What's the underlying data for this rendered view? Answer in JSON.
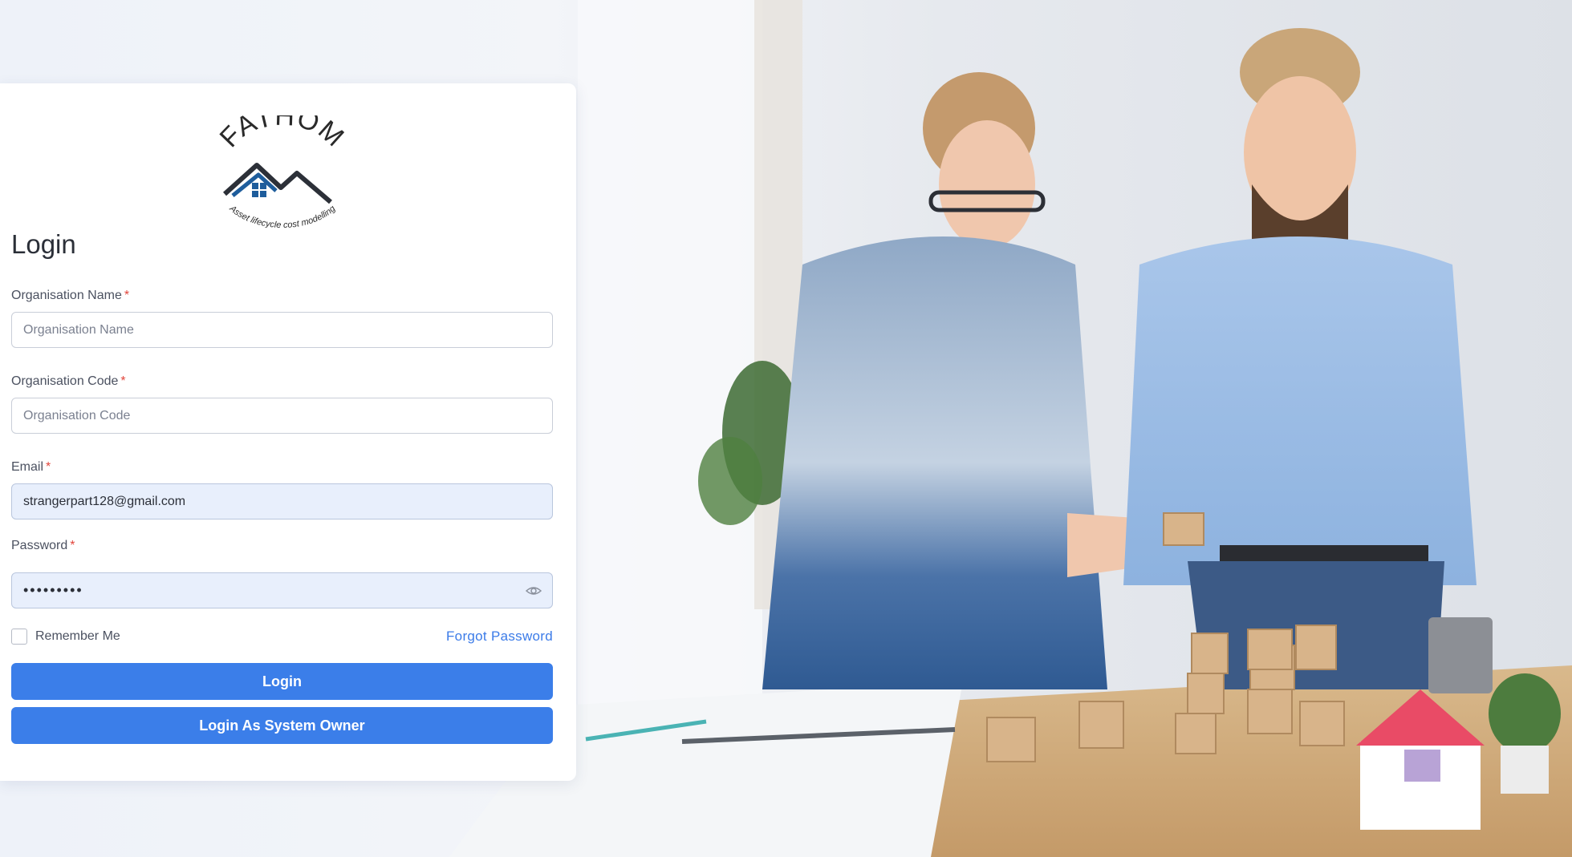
{
  "brand": {
    "logo_name": "FATHOM",
    "logo_tagline": "Asset lifecycle cost modelling"
  },
  "login": {
    "title": "Login",
    "org_name": {
      "label": "Organisation Name",
      "required_mark": "*",
      "placeholder": "Organisation Name",
      "value": ""
    },
    "org_code": {
      "label": "Organisation Code",
      "required_mark": "*",
      "placeholder": "Organisation Code",
      "value": ""
    },
    "email": {
      "label": "Email",
      "required_mark": "*",
      "value": "strangerpart128@gmail.com"
    },
    "password": {
      "label": "Password",
      "required_mark": "*",
      "value": "•••••••••",
      "toggle_icon": "eye-icon"
    },
    "remember_label": "Remember Me",
    "forgot_label": "Forgot Password",
    "login_button": "Login",
    "owner_button": "Login As System Owner"
  },
  "colors": {
    "primary": "#3b7ee9",
    "link": "#3b7be8",
    "required": "#e2463c",
    "filled_input_bg": "#e8effc"
  }
}
